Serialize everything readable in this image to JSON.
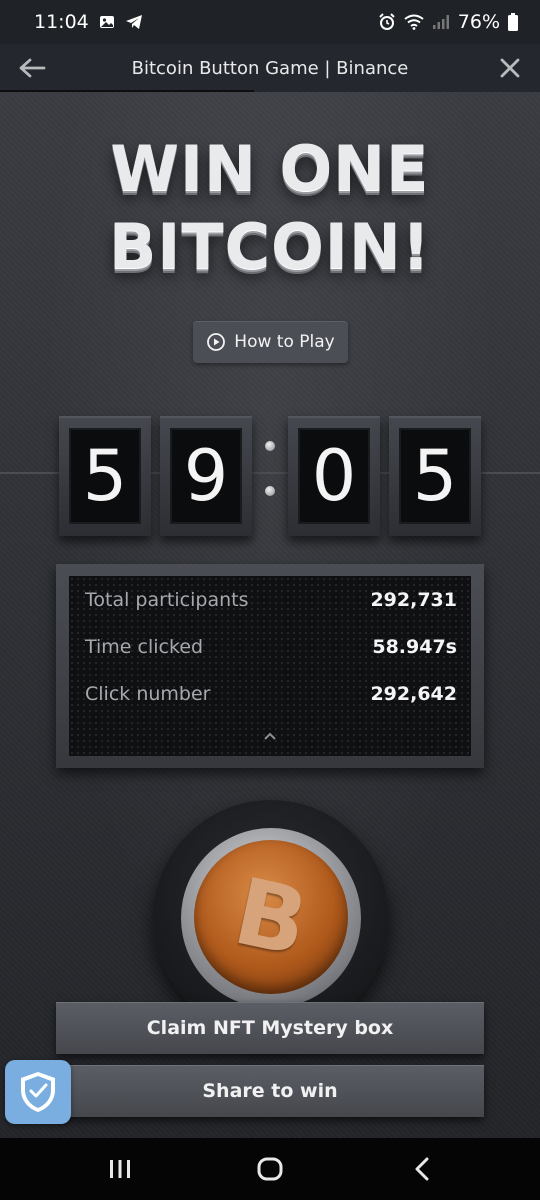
{
  "status_bar": {
    "time": "11:04",
    "battery": "76%",
    "icons": [
      "gallery-icon",
      "telegram-icon",
      "alarm-icon",
      "wifi-icon",
      "signal-icon",
      "battery-icon"
    ]
  },
  "app_bar": {
    "title": "Bitcoin Button Game | Binance",
    "back_icon": "back-arrow-icon",
    "close_icon": "close-icon"
  },
  "game": {
    "headline_line1": "WIN ONE",
    "headline_line2": "BITCOIN!",
    "how_to_play_label": "How to Play",
    "timer": {
      "digits": [
        "5",
        "9",
        "0",
        "5"
      ]
    },
    "stats": [
      {
        "label": "Total participants",
        "value": "292,731"
      },
      {
        "label": "Time clicked",
        "value": "58.947s"
      },
      {
        "label": "Click number",
        "value": "292,642"
      }
    ],
    "button_symbol": "B",
    "claim_label": "Claim NFT Mystery box",
    "share_label": "Share to win"
  },
  "colors": {
    "accent_orange": "#b05a1c",
    "panel_dark": "#0f1012",
    "shield_blue": "#7aaee0"
  }
}
